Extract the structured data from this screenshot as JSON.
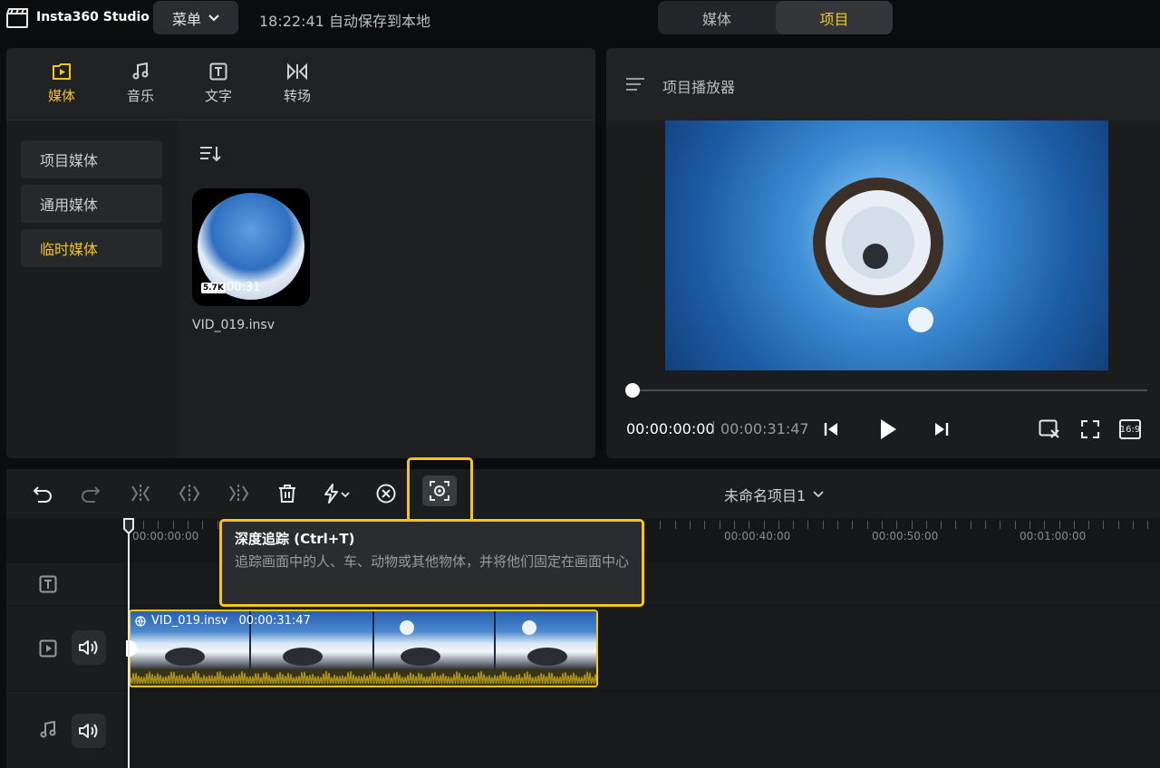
{
  "app": {
    "title": "Insta360 Studio",
    "menu_label": "菜单",
    "autosave_text": "18:22:41 自动保存到本地"
  },
  "mode_switch": {
    "media": "媒体",
    "project": "项目",
    "active": "project"
  },
  "media_panel": {
    "tabs": [
      {
        "label": "媒体",
        "icon": "media-play-icon",
        "active": true
      },
      {
        "label": "音乐",
        "icon": "music-note-icon",
        "active": false
      },
      {
        "label": "文字",
        "icon": "text-icon",
        "active": false
      },
      {
        "label": "转场",
        "icon": "transition-icon",
        "active": false
      }
    ],
    "sidebar": [
      {
        "label": "项目媒体",
        "active": false
      },
      {
        "label": "通用媒体",
        "active": false
      },
      {
        "label": "临时媒体",
        "active": true
      }
    ],
    "file": {
      "name": "VID_019.insv",
      "resolution_badge": "5.7K",
      "duration": "00:31"
    }
  },
  "player": {
    "title": "项目播放器",
    "current_time": "00:00:00:00",
    "separator": "|",
    "total_time": "00:00:31:47",
    "aspect_label": "16:9"
  },
  "timeline": {
    "project_name": "未命名项目1",
    "ruler_labels": [
      "00:00:00:00",
      "00:00:40:00",
      "00:00:50:00",
      "00:01:00:00"
    ],
    "clip": {
      "name": "VID_019.insv",
      "duration": "00:00:31:47"
    }
  },
  "tooltip": {
    "title": "深度追踪 (Ctrl+T)",
    "description": "追踪画面中的人、车、动物或其他物体，并将他们固定在画面中心"
  },
  "colors": {
    "accent": "#f3c623",
    "highlight_border": "#f5c518",
    "panel": "#1b1c1e",
    "background": "#0b0c0d"
  }
}
